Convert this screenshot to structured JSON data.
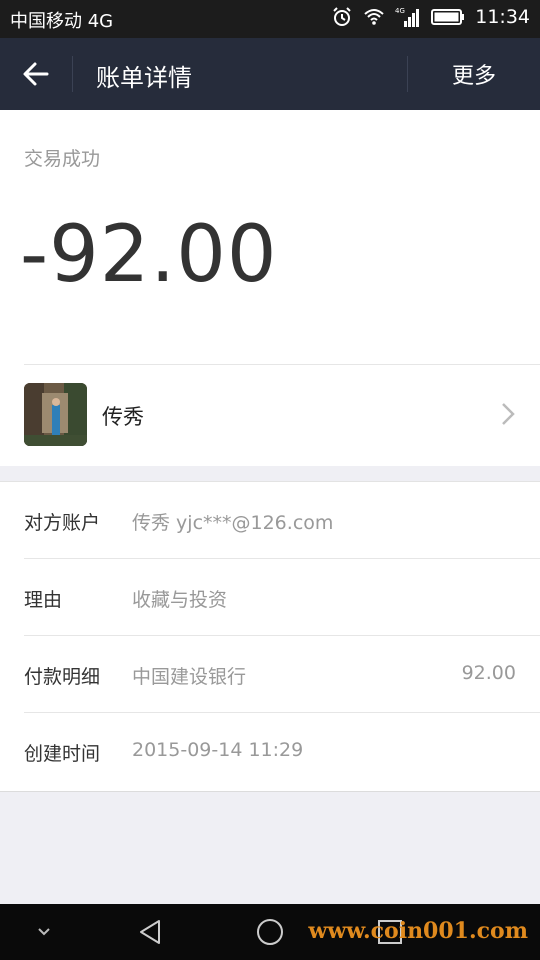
{
  "status_bar": {
    "carrier": "中国移动 4G",
    "network_badge": "4G",
    "time": "11:34",
    "icons": [
      "alarm-icon",
      "wifi-icon",
      "signal-icon",
      "battery-icon"
    ]
  },
  "header": {
    "title": "账单详情",
    "more_label": "更多",
    "back_icon": "arrow-left-icon"
  },
  "transaction": {
    "status": "交易成功",
    "amount": "-92.00",
    "payee_name": "传秀"
  },
  "details": [
    {
      "label": "对方账户",
      "value": "传秀 yjc***@126.com",
      "right": ""
    },
    {
      "label": "理由",
      "value": "收藏与投资",
      "right": ""
    },
    {
      "label": "付款明细",
      "value": "中国建设银行",
      "right": "92.00"
    },
    {
      "label": "创建时间",
      "value": "2015-09-14 11:29",
      "right": ""
    }
  ],
  "navbar": {
    "icons": [
      "chevron-down-icon",
      "back-triangle-icon",
      "home-circle-icon",
      "recent-square-icon"
    ],
    "watermark": "www.coin001.com"
  },
  "colors": {
    "header_bg": "#262c3b",
    "status_bg": "#1c1c1c",
    "page_bg": "#efeff4",
    "watermark": "#e08a1e"
  }
}
